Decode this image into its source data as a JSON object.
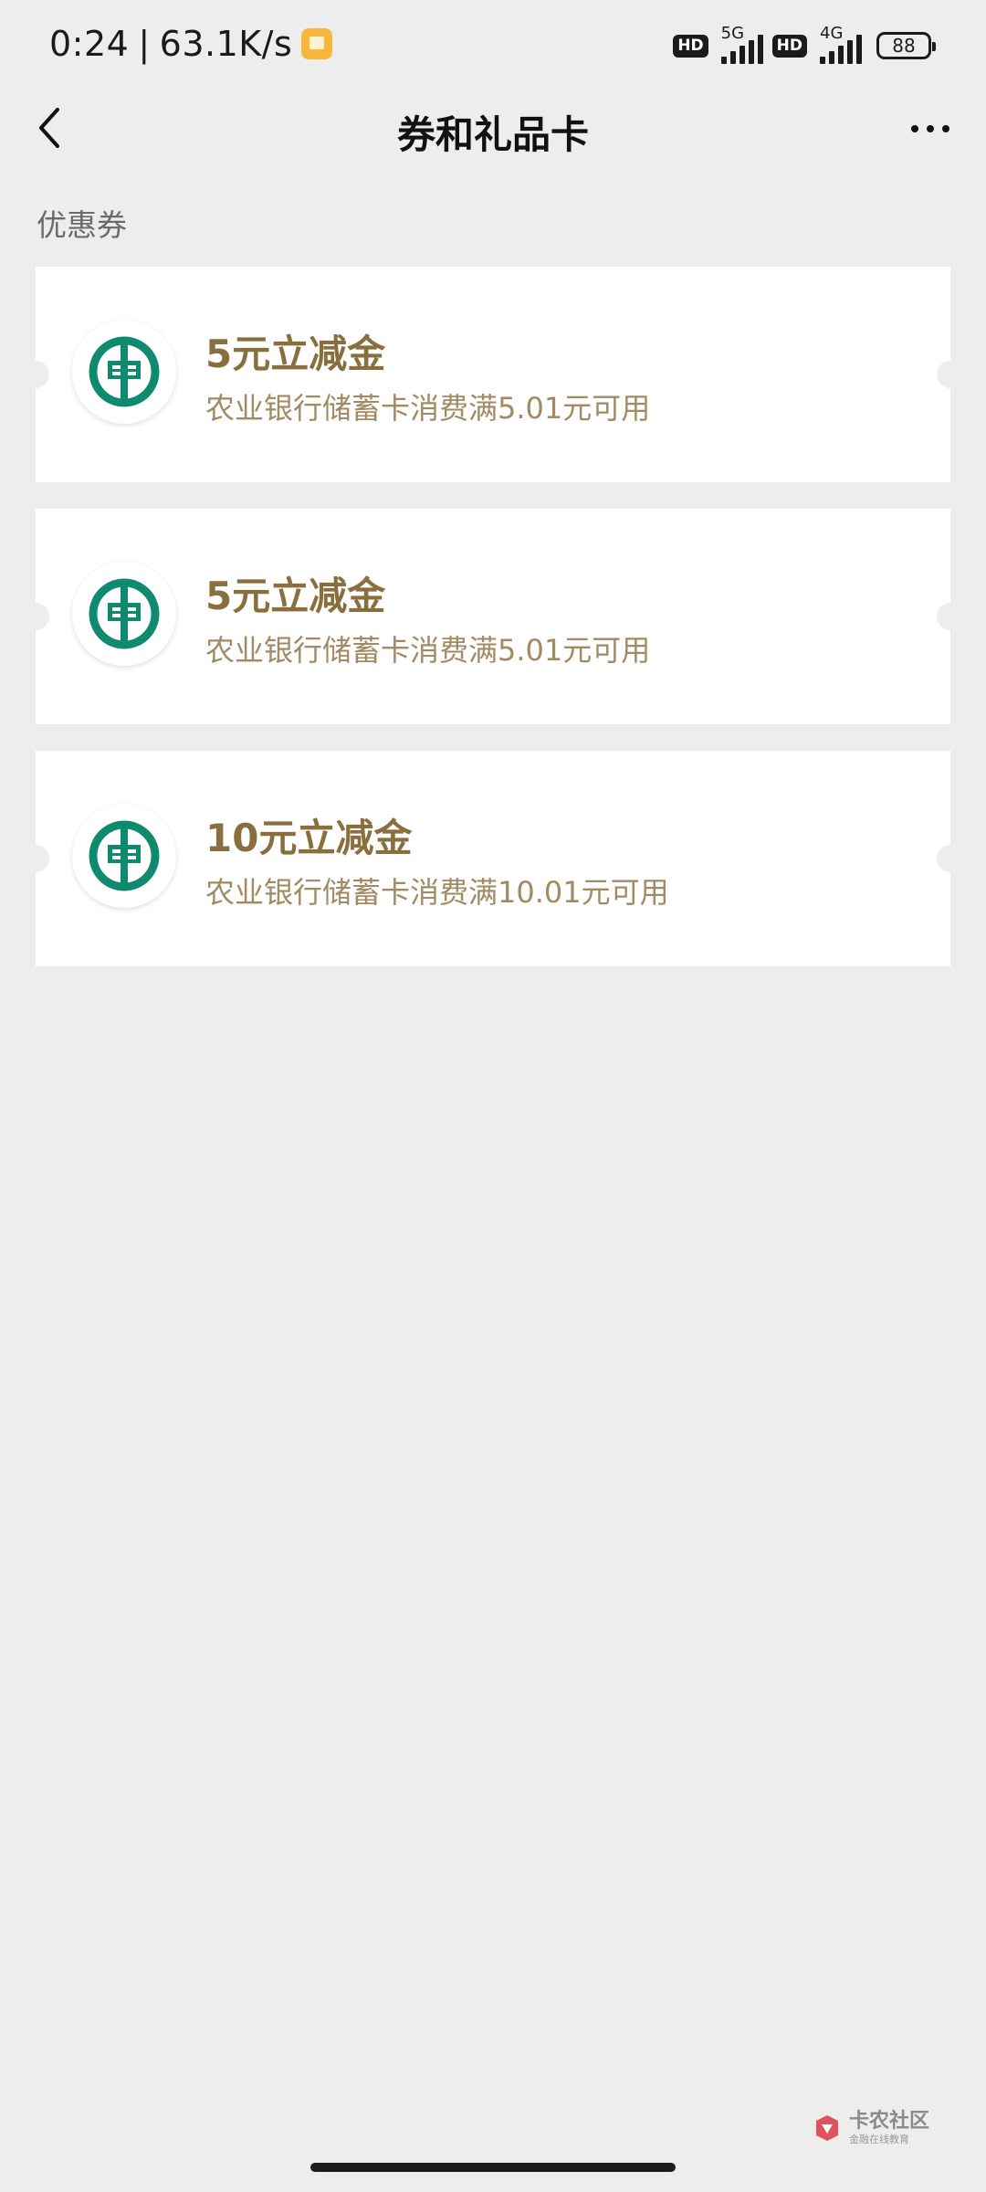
{
  "status_bar": {
    "time": "0:24",
    "speed": "63.1K/s",
    "network1": "5G",
    "network2": "4G",
    "hd_label": "HD",
    "battery": "88"
  },
  "header": {
    "title": "券和礼品卡"
  },
  "section": {
    "label": "优惠券"
  },
  "coupons": [
    {
      "title": "5元立减金",
      "desc": "农业银行储蓄卡消费满5.01元可用"
    },
    {
      "title": "5元立减金",
      "desc": "农业银行储蓄卡消费满5.01元可用"
    },
    {
      "title": "10元立减金",
      "desc": "农业银行储蓄卡消费满10.01元可用"
    }
  ],
  "watermark": {
    "name": "卡农社区",
    "sub": "金融在线教育"
  },
  "colors": {
    "background": "#ededed",
    "coupon_title": "#8a6f3e",
    "coupon_desc": "#a28a63",
    "abc_green": "#0f8a6f"
  }
}
